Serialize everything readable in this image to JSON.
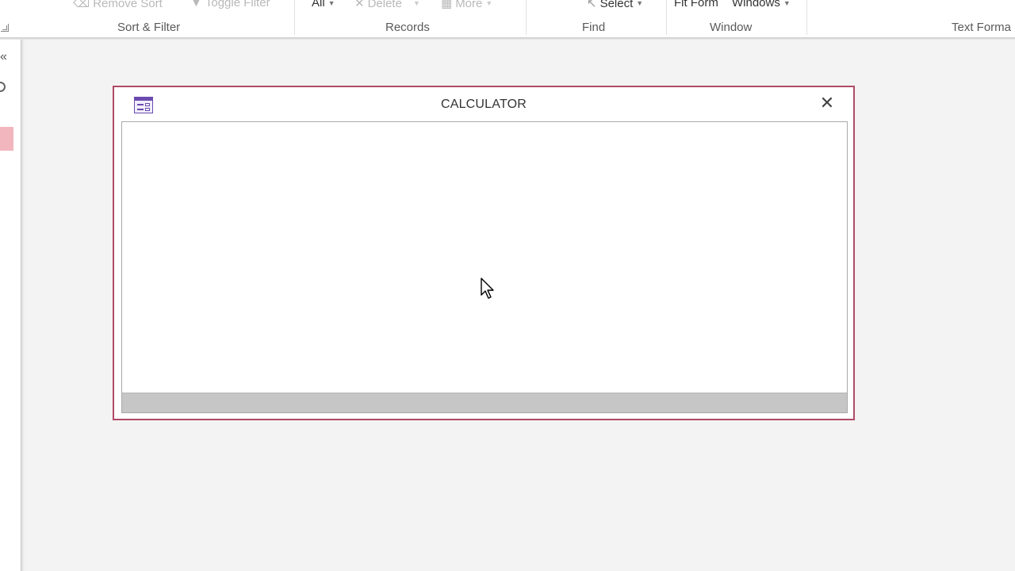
{
  "ribbon": {
    "sort_filter": {
      "label": "Sort & Filter",
      "remove_sort": "Remove Sort",
      "toggle_filter": "Toggle Filter"
    },
    "records": {
      "label": "Records",
      "refresh_all": "All",
      "delete": "Delete",
      "more": "More"
    },
    "find": {
      "label": "Find",
      "select": "Select"
    },
    "window": {
      "label": "Window",
      "fit_form": "Fit Form",
      "switch_windows": "Windows"
    },
    "text_formatting": {
      "label": "Text Forma"
    }
  },
  "nav_pane": {
    "collapse_glyph": "«"
  },
  "form": {
    "title": "CALCULATOR",
    "close_glyph": "✕",
    "accent_color": "#b04a68"
  },
  "icons": {
    "form": "form-icon",
    "close": "close-icon",
    "remove_sort": "eraser-sort-icon",
    "delete": "delete-x-icon",
    "more": "more-grid-icon",
    "select": "select-arrow-icon"
  }
}
